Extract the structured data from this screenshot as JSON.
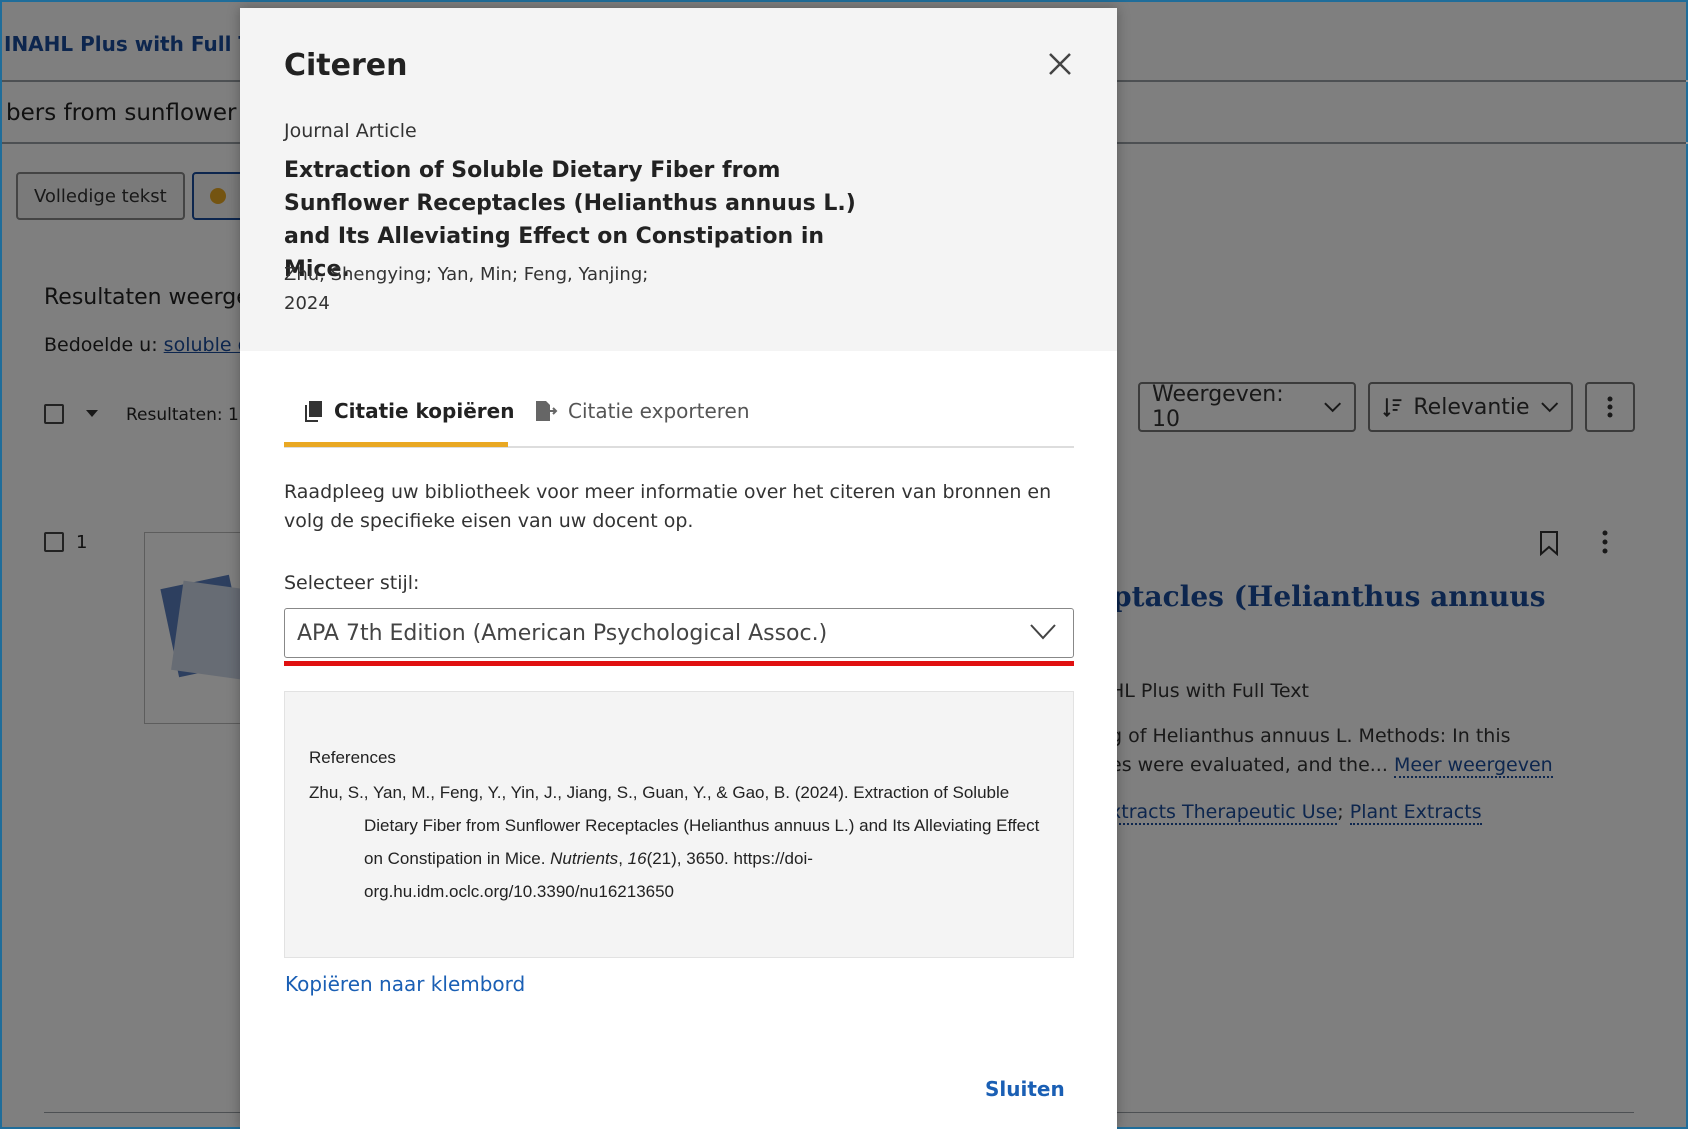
{
  "background": {
    "database": "INAHL Plus with Full Text",
    "query": "bers from sunflower",
    "fulltext_button": "Volledige tekst",
    "results_heading": "Resultaten weergev",
    "did_you_mean_label": "Bedoelde u:",
    "did_you_mean_link": "soluble di",
    "results_count": "Resultaten: 1",
    "show_select": "Weergeven: 10",
    "sort_select": "Relevantie",
    "result_number": "1",
    "result_title_fragment": "ptacles (Helianthus annuus",
    "result_source_fragment": "HL Plus with Full Text",
    "result_abstract_line1": "g of Helianthus annuus L. Methods: In this",
    "result_abstract_line2": "es were evaluated, and the...",
    "show_more_link": "Meer weergeven",
    "subject1": "xtracts Therapeutic Use",
    "subject2": "Plant Extracts"
  },
  "modal": {
    "title": "Citeren",
    "doc_type": "Journal Article",
    "doc_title": "Extraction of Soluble Dietary Fiber from\nSunflower Receptacles (Helianthus annuus L.)\nand Its Alleviating Effect on Constipation in Mice.",
    "authors": "Zhu, Shengying; Yan, Min; Feng, Yanjing;",
    "year": "2024",
    "tabs": [
      {
        "label": "Citatie kopiëren",
        "icon": "copy-icon",
        "active": true
      },
      {
        "label": "Citatie exporteren",
        "icon": "export-icon",
        "active": false
      }
    ],
    "info_text": "Raadpleeg uw bibliotheek voor meer informatie over het citeren van bronnen en volg de specifieke eisen van uw docent op.",
    "style_label": "Selecteer stijl:",
    "style_value": "APA 7th Edition (American Psychological Assoc.)",
    "citation": {
      "heading": "References",
      "part1": "Zhu, S., Yan, M., Feng, Y., Yin, J., Jiang, S., Guan, Y., & Gao, B. (2024). Extraction of Soluble Dietary Fiber from Sunflower Receptacles (Helianthus annuus L.) and Its Alleviating Effect on Constipation in Mice. ",
      "journal": "Nutrients",
      "part2": ", ",
      "volume": "16",
      "part3": "(21), 3650. https://doi-org.hu.idm.oclc.org/10.3390/nu16213650"
    },
    "copy_link": "Kopiëren naar klembord",
    "close_button": "Sluiten"
  },
  "colors": {
    "accent_tab": "#e9a823",
    "highlight_red": "#e01010",
    "link_blue": "#1a5fb4"
  }
}
